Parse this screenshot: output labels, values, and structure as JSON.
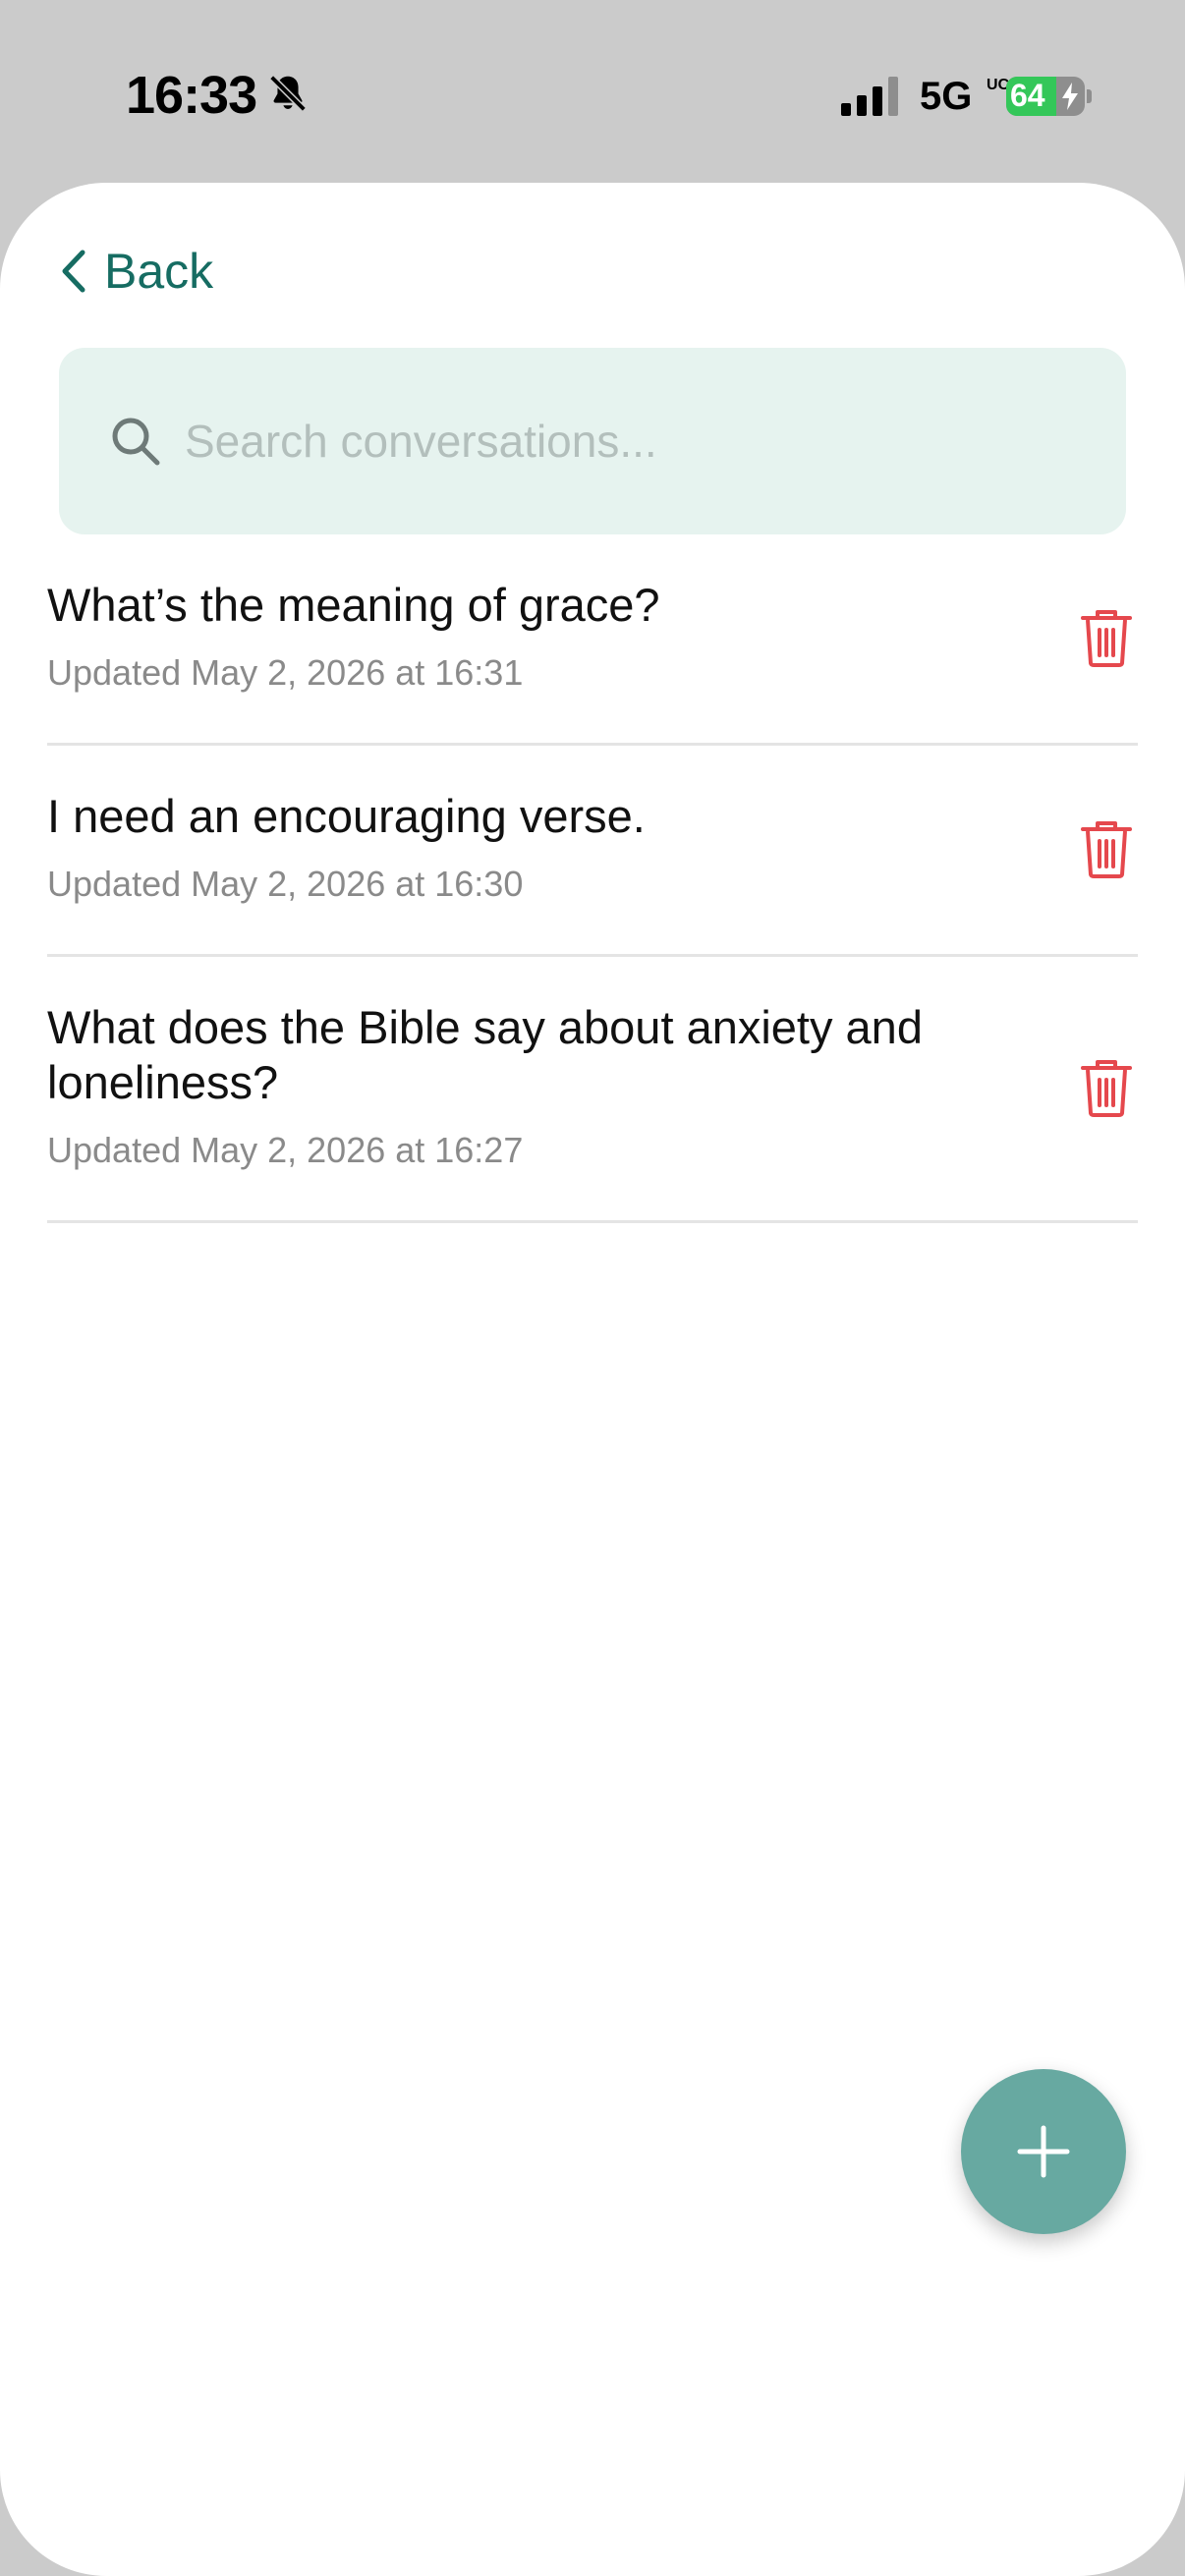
{
  "status_bar": {
    "time": "16:33",
    "silent_icon": "bell-slash-icon",
    "signal_icon": "cellular-signal-icon",
    "network": "5G",
    "network_sub": "UC",
    "battery_level": "64",
    "battery_fraction": 0.64,
    "charging_icon": "bolt-icon"
  },
  "header": {
    "back_label": "Back",
    "back_icon": "chevron-left-icon"
  },
  "search": {
    "placeholder": "Search conversations...",
    "value": "",
    "icon": "search-icon"
  },
  "conversations": [
    {
      "title": "What’s the meaning of grace?",
      "updated": "Updated May 2, 2026 at 16:31"
    },
    {
      "title": "I need an encouraging verse.",
      "updated": "Updated May 2, 2026 at 16:30"
    },
    {
      "title": "What does the Bible say about anxiety and loneliness?",
      "updated": "Updated May 2, 2026 at 16:27"
    }
  ],
  "actions": {
    "delete_icon": "trash-icon",
    "new_icon": "plus-icon"
  },
  "colors": {
    "accent": "#166c62",
    "search_bg": "#e6f3ef",
    "delete": "#e5484d",
    "fab": "#67a9a1",
    "battery": "#34c759"
  }
}
